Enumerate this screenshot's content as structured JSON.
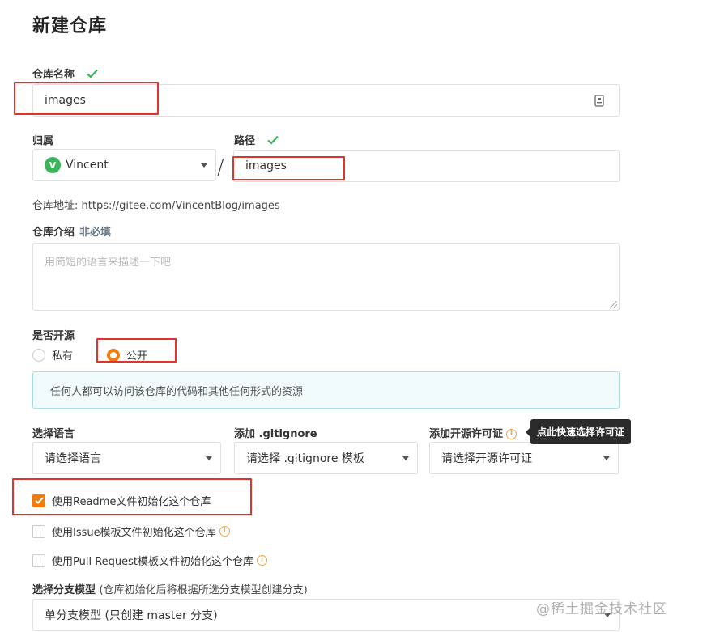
{
  "page": {
    "title": "新建仓库"
  },
  "repo_name": {
    "label": "仓库名称",
    "value": "images"
  },
  "owner": {
    "label": "归属",
    "avatar_letter": "V",
    "value": "Vincent"
  },
  "separator": "/",
  "path": {
    "label": "路径",
    "value": "images"
  },
  "repo_address": {
    "label": "仓库地址:",
    "url": "https://gitee.com/VincentBlog/images"
  },
  "description": {
    "label": "仓库介绍",
    "optional_label": "非必填",
    "placeholder": "用简短的语言来描述一下吧"
  },
  "visibility": {
    "label": "是否开源",
    "options": [
      {
        "label": "私有",
        "selected": false
      },
      {
        "label": "公开",
        "selected": true
      }
    ]
  },
  "notice": "任何人都可以访问该仓库的代码和其他任何形式的资源",
  "language": {
    "label": "选择语言",
    "value": "请选择语言"
  },
  "gitignore": {
    "label": "添加 .gitignore",
    "value": "请选择 .gitignore 模板"
  },
  "license": {
    "label": "添加开源许可证",
    "value": "请选择开源许可证",
    "tooltip": "点此快速选择许可证"
  },
  "init_options": [
    {
      "label": "使用Readme文件初始化这个仓库",
      "checked": true,
      "info": false
    },
    {
      "label": "使用Issue模板文件初始化这个仓库",
      "checked": false,
      "info": true
    },
    {
      "label": "使用Pull Request模板文件初始化这个仓库",
      "checked": false,
      "info": true
    }
  ],
  "branch_model": {
    "label": "选择分支模型",
    "hint": "(仓库初始化后将根据所选分支模型创建分支)",
    "value": "单分支模型 (只创建 master 分支)"
  },
  "watermark": "@稀土掘金技术社区",
  "colors": {
    "accent": "#f27a0b",
    "valid": "#3cb45c",
    "highlight_box": "#e0332b",
    "notice_bg": "#f1fbfb",
    "notice_border": "#a9dede"
  },
  "icons": {
    "valid": "check-icon",
    "input_badge": "id-badge-icon",
    "info": "info-circle-icon",
    "dropdown": "caret-down-icon"
  }
}
